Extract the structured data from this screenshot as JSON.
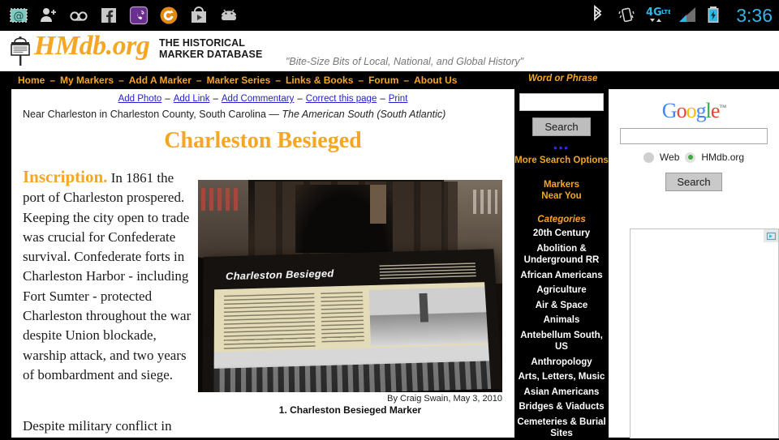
{
  "statusbar": {
    "notifications": [
      {
        "name": "email-stamp-icon",
        "glyph": "@"
      },
      {
        "name": "contact-add-icon",
        "glyph": ""
      },
      {
        "name": "voicemail-icon",
        "glyph": ""
      },
      {
        "name": "facebook-icon",
        "glyph": "f"
      },
      {
        "name": "viber-icon",
        "glyph": ""
      },
      {
        "name": "ccleaner-icon",
        "glyph": ""
      },
      {
        "name": "play-store-icon",
        "glyph": ""
      },
      {
        "name": "android-icon",
        "glyph": ""
      }
    ],
    "indicators": [
      {
        "name": "bluetooth-icon"
      },
      {
        "name": "vibrate-icon"
      },
      {
        "name": "network-4glte-icon",
        "label": "4G"
      },
      {
        "name": "signal-bars-icon"
      },
      {
        "name": "battery-charging-icon"
      }
    ],
    "clock": "3:36",
    "accent_color": "#33b5e5"
  },
  "header": {
    "logo_text": "HMdb.org",
    "logo_sub_line1": "THE HISTORICAL",
    "logo_sub_line2": "MARKER DATABASE",
    "tagline": "\"Bite-Size Bits of Local, National, and Global History\"",
    "logo_color": "#f5a623"
  },
  "nav": {
    "items": [
      "Home",
      "My Markers",
      "Add A Marker",
      "Marker Series",
      "Links & Books",
      "Forum",
      "About Us"
    ],
    "separator": "–",
    "word_or_phrase_label": "Word or Phrase"
  },
  "page_actions": {
    "items": [
      "Add Photo",
      "Add Link",
      "Add Commentary",
      "Correct this page",
      "Print"
    ],
    "separator": "–"
  },
  "marker": {
    "location": "Near Charleston in Charleston County, South Carolina — ",
    "region": "The American South (South Atlantic)",
    "title": "Charleston Besieged",
    "inscription_label": "Inscription.",
    "inscription_p1": " In 1861 the port of Charleston prospered. Keeping the city open to trade was crucial for Confederate survival. Confederate forts in Charleston Harbor - including Fort Sumter - protected Charleston throughout the war despite Union blockade, warship attack, and two years of bombardment and siege.",
    "inscription_p2": "Despite military conflict in",
    "photo_panel_title": "Charleston Besieged",
    "photo_credit": "By Craig Swain, May 3, 2010",
    "photo_caption": "1. Charleston Besieged Marker"
  },
  "sidebar_search": {
    "input_value": "",
    "search_button": "Search",
    "dots": "•••",
    "more_options": "More Search Options",
    "markers_near_you_line1": "Markers",
    "markers_near_you_line2": "Near You",
    "categories_heading": "Categories",
    "categories": [
      "20th Century",
      "Abolition & Underground RR",
      "African Americans",
      "Agriculture",
      "Air & Space",
      "Animals",
      "Antebellum South, US",
      "Anthropology",
      "Arts, Letters, Music",
      "Asian Americans",
      "Bridges & Viaducts",
      "Cemeteries & Burial Sites"
    ],
    "accent_color": "#f5a623"
  },
  "google_search": {
    "logo_letters": [
      "G",
      "o",
      "o",
      "g",
      "l",
      "e"
    ],
    "trademark": "™",
    "input_value": "",
    "scope_web": "Web",
    "scope_site": "HMdb.org",
    "selected_scope": "HMdb.org",
    "search_button": "Search",
    "ad_label": "AdChoices"
  }
}
